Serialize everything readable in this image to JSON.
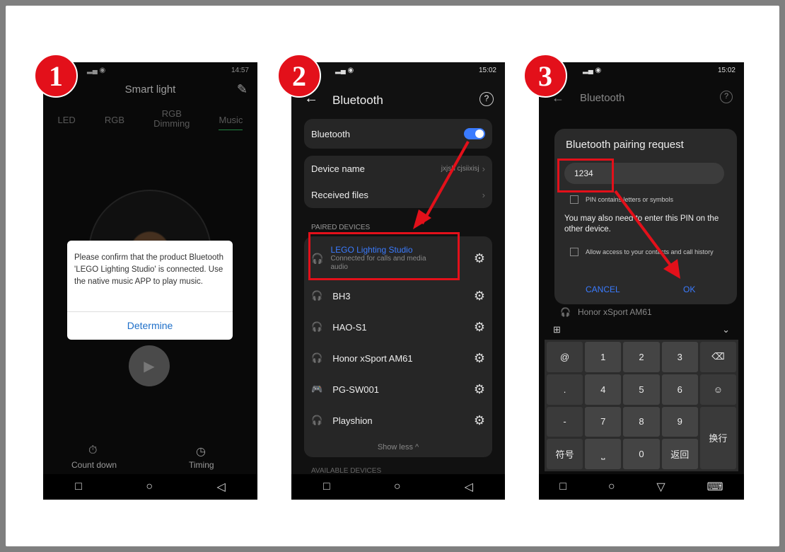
{
  "steps": [
    "1",
    "2",
    "3"
  ],
  "p1": {
    "time": "14:57",
    "title": "Smart light",
    "tabs": [
      "LED",
      "RGB",
      "RGB\nDimming",
      "Music"
    ],
    "dialog_text": "Please confirm that the product Bluetooth 'LEGO Lighting Studio' is connected. Use the native music APP to play music.",
    "dialog_button": "Determine",
    "countdown": "Count down",
    "timing": "Timing"
  },
  "p2": {
    "time": "15:02",
    "title": "Bluetooth",
    "toggle_label": "Bluetooth",
    "device_name_label": "Device name",
    "device_name_value": "jxjsh cjsiixisj",
    "received_files": "Received files",
    "paired_header": "PAIRED DEVICES",
    "devices": [
      {
        "name": "LEGO Lighting Studio",
        "sub": "Connected for calls and media audio"
      },
      {
        "name": "BH3"
      },
      {
        "name": "HAO-S1"
      },
      {
        "name": "Honor xSport AM61"
      },
      {
        "name": "PG-SW001"
      },
      {
        "name": "Playshion"
      }
    ],
    "show_less": "Show less",
    "available": "AVAILABLE DEVICES"
  },
  "p3": {
    "time": "15:02",
    "title": "Bluetooth",
    "dialog_title": "Bluetooth pairing request",
    "pin": "1234",
    "pin_option": "PIN contains letters or symbols",
    "hint": "You may also need to enter this PIN on the other device.",
    "contacts_option": "Allow access to your contacts and call history",
    "cancel": "CANCEL",
    "ok": "OK",
    "behind_device": "Honor xSport AM61",
    "keys": {
      "at": "@",
      "dot": ".",
      "plus": "+",
      "minus": "-",
      "symbol": "符号",
      "return": "返回",
      "newline": "换行",
      "n1": "1",
      "n2": "2",
      "n3": "3",
      "n4": "4",
      "n5": "5",
      "n6": "6",
      "n7": "7",
      "n8": "8",
      "n9": "9",
      "n0": "0"
    }
  },
  "colors": {
    "highlight": "#e3101a",
    "accent": "#3a7bff"
  }
}
